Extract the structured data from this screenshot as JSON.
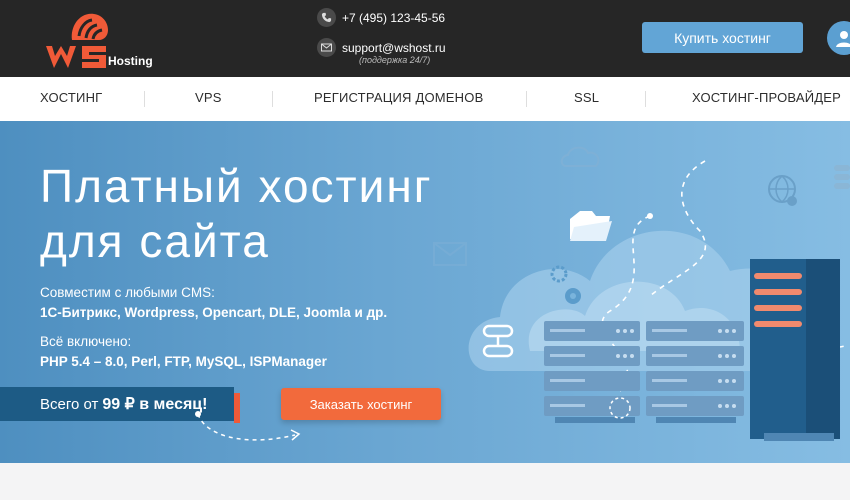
{
  "header": {
    "logo_text": "Hosting",
    "phone": "+7 (495) 123-45-56",
    "email": "support@wshost.ru",
    "support_note": "(поддержка 24/7)",
    "buy_button": "Купить хостинг",
    "icons": [
      "phone-icon",
      "mail-icon",
      "user-icon"
    ]
  },
  "nav": {
    "items": [
      "ХОСТИНГ",
      "VPS",
      "РЕГИСТРАЦИЯ ДОМЕНОВ",
      "SSL",
      "ХОСТИНГ-ПРОВАЙДЕР"
    ]
  },
  "hero": {
    "title_line1": "Платный хостинг",
    "title_line2": "для сайта",
    "cms_label": "Совместим с любыми CMS:",
    "cms_list": "1С-Битрикс, Wordpress, Opencart, DLE, Joomla и др.",
    "included_label": "Всё включено:",
    "included_list": "PHP 5.4 – 8.0, Perl, FTP, MySQL, ISPManager",
    "price_prefix": "Всего от",
    "price_value": "99 ₽ в месяц!",
    "order_button": "Заказать хостинг"
  },
  "colors": {
    "topbar": "#262626",
    "accent_orange": "#f26a3c",
    "accent_blue": "#62a5d6",
    "price_bg": "#1d5b85"
  }
}
